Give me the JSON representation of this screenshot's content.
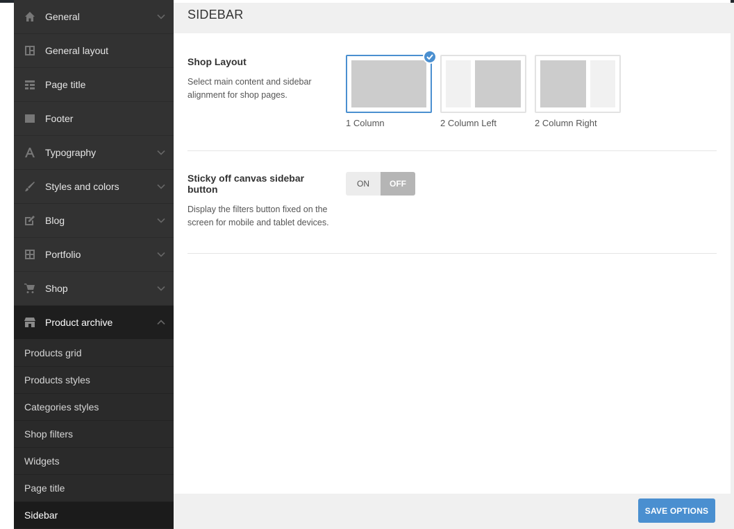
{
  "sidebar": {
    "items": [
      {
        "label": "General",
        "icon": "home-icon",
        "chevron": "down"
      },
      {
        "label": "General layout",
        "icon": "layout-icon",
        "chevron": ""
      },
      {
        "label": "Page title",
        "icon": "title-icon",
        "chevron": ""
      },
      {
        "label": "Footer",
        "icon": "footer-icon",
        "chevron": ""
      },
      {
        "label": "Typography",
        "icon": "typography-icon",
        "chevron": "down"
      },
      {
        "label": "Styles and colors",
        "icon": "brush-icon",
        "chevron": "down"
      },
      {
        "label": "Blog",
        "icon": "edit-icon",
        "chevron": "down"
      },
      {
        "label": "Portfolio",
        "icon": "grid-icon",
        "chevron": "down"
      },
      {
        "label": "Shop",
        "icon": "cart-icon",
        "chevron": "down"
      },
      {
        "label": "Product archive",
        "icon": "store-icon",
        "chevron": "up"
      }
    ],
    "sub_items": [
      {
        "label": "Products grid"
      },
      {
        "label": "Products styles"
      },
      {
        "label": "Categories styles"
      },
      {
        "label": "Shop filters"
      },
      {
        "label": "Widgets"
      },
      {
        "label": "Page title"
      },
      {
        "label": "Sidebar"
      }
    ]
  },
  "main": {
    "title": "SIDEBAR",
    "shop_layout": {
      "title": "Shop Layout",
      "description": "Select main content and sidebar alignment for shop pages.",
      "options": [
        {
          "label": "1 Column",
          "selected": true
        },
        {
          "label": "2 Column Left",
          "selected": false
        },
        {
          "label": "2 Column Right",
          "selected": false
        }
      ]
    },
    "sticky_button": {
      "title": "Sticky off canvas sidebar button",
      "description": "Display the filters button fixed on the screen for mobile and tablet devices.",
      "on_label": "ON",
      "off_label": "OFF",
      "value": "OFF"
    }
  },
  "footer": {
    "save_label": "SAVE OPTIONS"
  },
  "colors": {
    "accent": "#4a8fd0",
    "sidebar_bg": "#323232",
    "active_bg": "#1e1e1e"
  }
}
